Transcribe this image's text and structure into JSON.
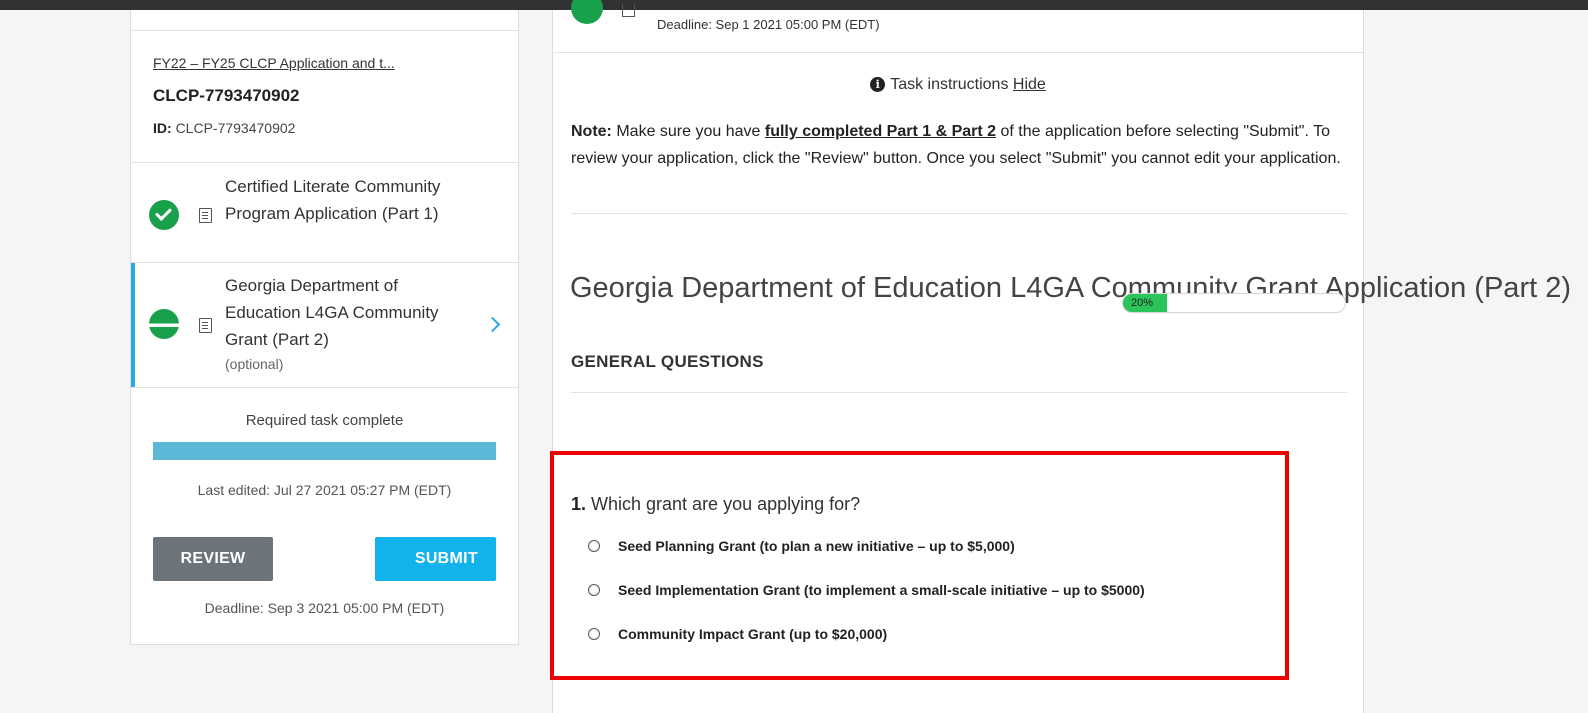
{
  "sidebar": {
    "project_link": "FY22 – FY25 CLCP Application and t...",
    "project_code": "CLCP-7793470902",
    "id_label": "ID:",
    "id_value": "CLCP-7793470902",
    "tasks": [
      {
        "label": "Certified Literate Community Program Application (Part 1)",
        "status": "complete"
      },
      {
        "label": "Georgia Department of Education L4GA Community Grant (Part 2)",
        "sub": "(optional)",
        "status": "in-progress",
        "active": true
      }
    ],
    "required_status": "Required task complete",
    "required_progress": 1.0,
    "last_edited": "Last edited: Jul 27 2021 05:27 PM (EDT)",
    "review_label": "REVIEW",
    "submit_label": "SUBMIT",
    "deadline": "Deadline: Sep 3 2021 05:00 PM (EDT)"
  },
  "main": {
    "top_deadline": "Deadline: Sep 1 2021 05:00 PM (EDT)",
    "instructions_label": "Task instructions",
    "hide_label": "Hide",
    "note_prefix": "Note:",
    "note_part1": " Make sure you have ",
    "note_emphasis": "fully completed Part 1 & Part 2",
    "note_part2": " of the application before selecting \"Submit\". To review your application, click the \"Review\" button. Once you select \"Submit\" you cannot edit your application.",
    "title": "Georgia Department of Education L4GA Community Grant Application (Part 2)",
    "progress_label": "20%",
    "progress_value": 0.2,
    "section_heading": "GENERAL QUESTIONS",
    "question_number": "1.",
    "question_text": " Which grant are you applying for?",
    "options": [
      "Seed Planning Grant (to plan a new initiative – up to $5,000)",
      "Seed Implementation Grant (to implement a small-scale initiative – up to $5000)",
      "Community Impact Grant (up to $20,000)"
    ]
  },
  "colors": {
    "accent": "#29a9df",
    "success": "#18a04b",
    "submit": "#12b2ea",
    "review": "#6a7479",
    "highlight": "#ef0000"
  }
}
